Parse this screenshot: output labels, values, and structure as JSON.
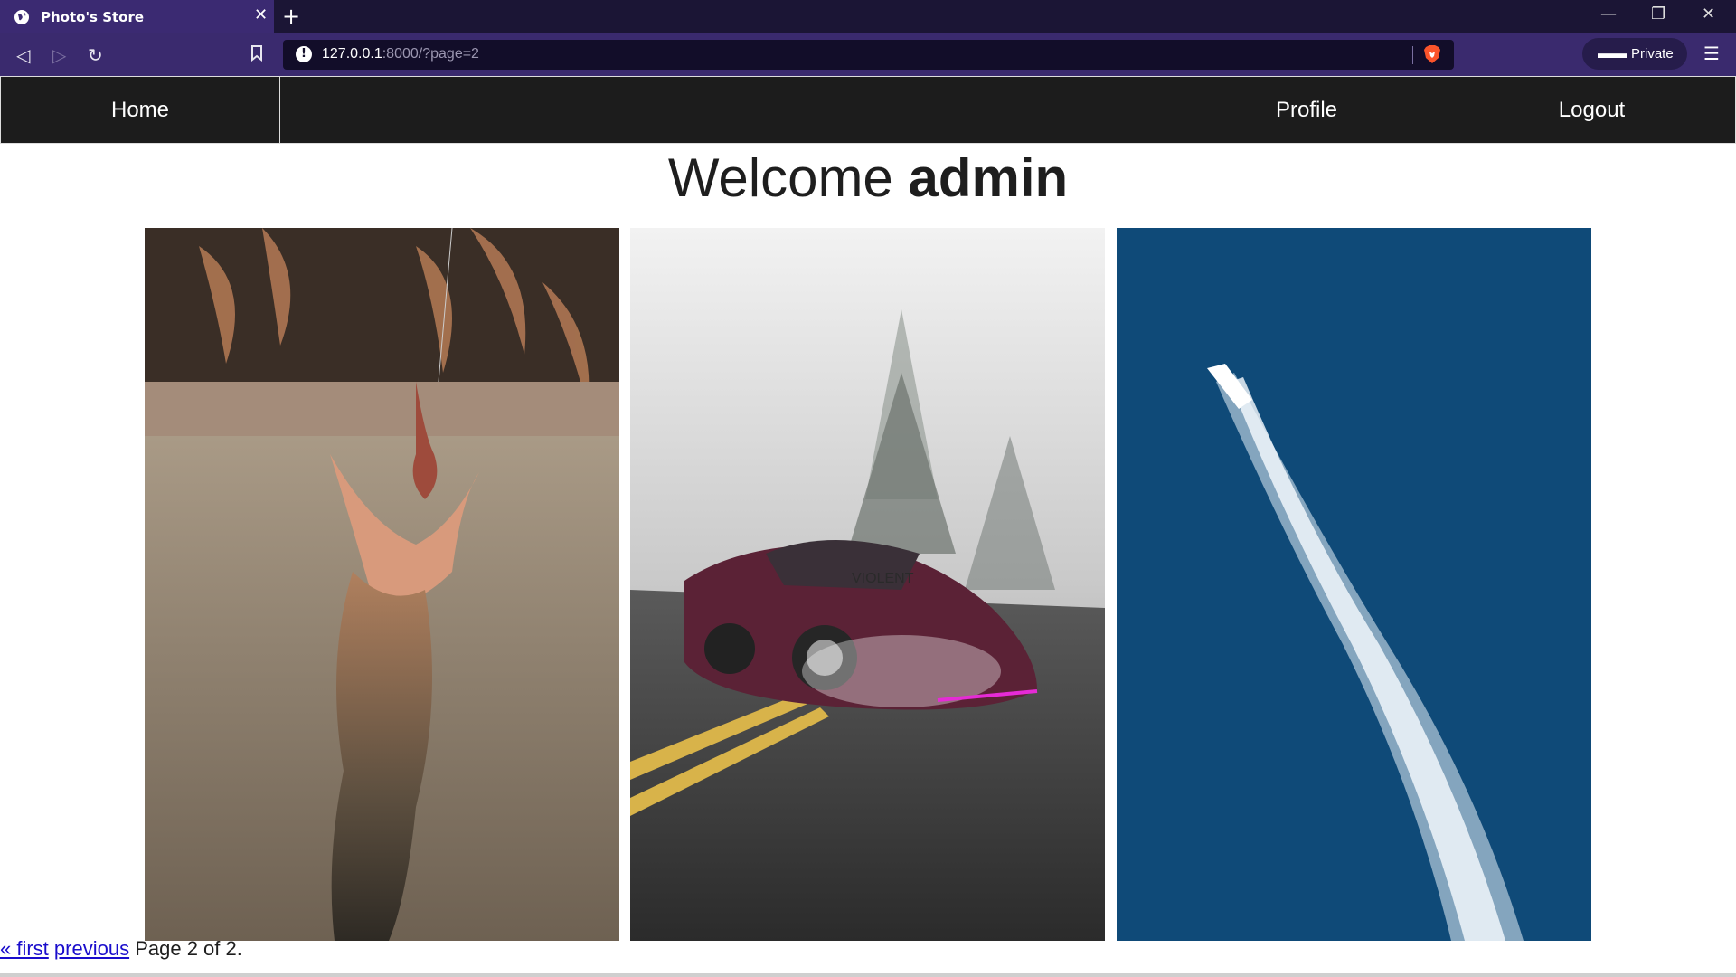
{
  "browser": {
    "tab_title": "Photo's Store",
    "url_host": "127.0.0.1",
    "url_rest": ":8000/?page=2",
    "private_label": "Private"
  },
  "nav": {
    "home": "Home",
    "profile": "Profile",
    "logout": "Logout"
  },
  "welcome": {
    "prefix": "Welcome ",
    "username": "admin"
  },
  "photos": [
    {
      "subject": "crocodile-leaping-for-meat"
    },
    {
      "subject": "pink-sports-car-on-foggy-road",
      "plate_text": "VIOLENT"
    },
    {
      "subject": "speedboat-on-blue-ocean"
    }
  ],
  "pagination": {
    "first": "« first",
    "previous": "previous",
    "status": "Page 2 of 2."
  }
}
